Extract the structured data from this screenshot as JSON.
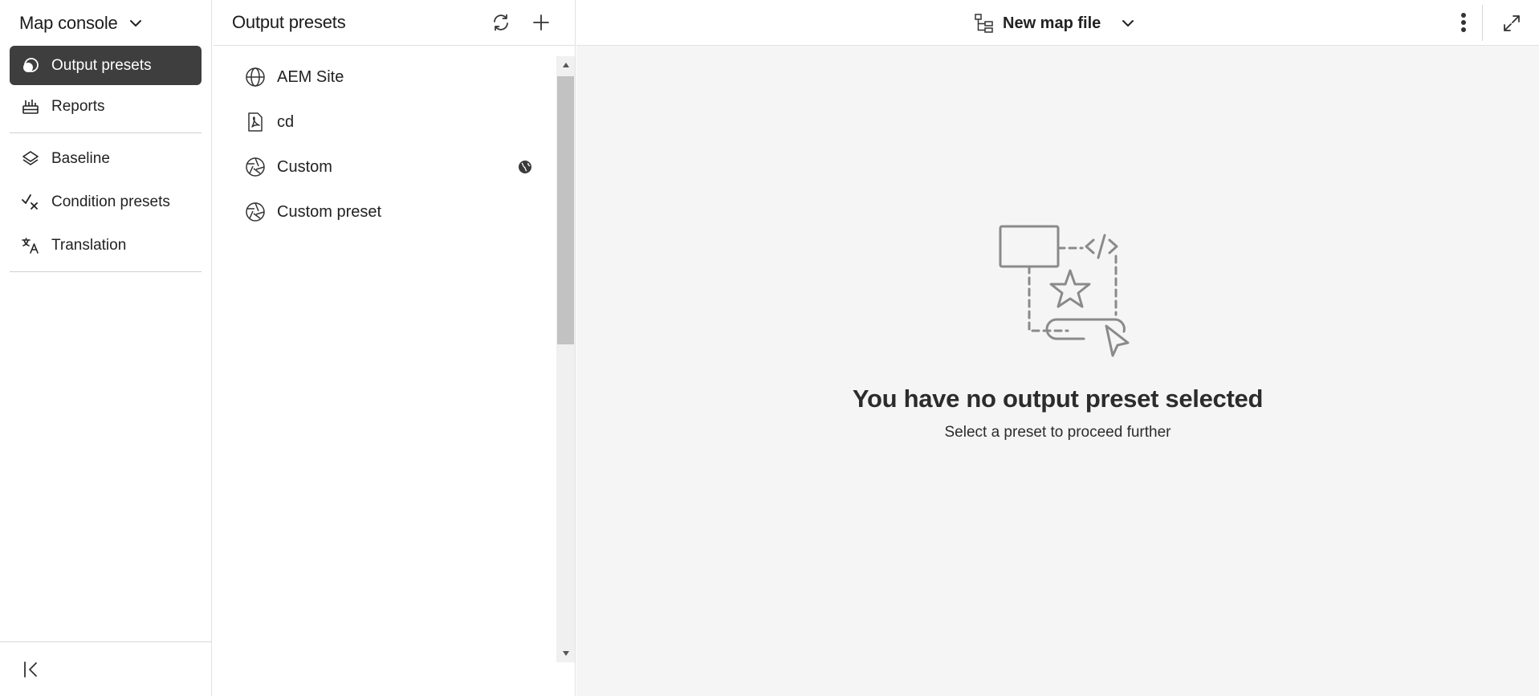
{
  "nav": {
    "title": "Map console",
    "title_chevron_icon": "chevron-down-icon",
    "items": [
      {
        "label": "Output presets",
        "icon": "output-presets-icon",
        "active": true
      },
      {
        "label": "Reports",
        "icon": "reports-icon",
        "active": false
      }
    ],
    "items2": [
      {
        "label": "Baseline",
        "icon": "layers-icon"
      },
      {
        "label": "Condition presets",
        "icon": "condition-icon"
      },
      {
        "label": "Translation",
        "icon": "translate-icon"
      }
    ],
    "collapse_icon": "collapse-left-icon"
  },
  "presets": {
    "title": "Output presets",
    "refresh_icon": "refresh-icon",
    "add_icon": "add-icon",
    "items": [
      {
        "label": "AEM Site",
        "icon": "globe-icon",
        "badge": null
      },
      {
        "label": "cd",
        "icon": "pdf-file-icon",
        "badge": null
      },
      {
        "label": "Custom",
        "icon": "aperture-icon",
        "badge": "global-badge-icon"
      },
      {
        "label": "Custom preset",
        "icon": "aperture-icon",
        "badge": null
      }
    ]
  },
  "main": {
    "file_name": "New map file",
    "file_icon": "tree-structure-icon",
    "file_chevron_icon": "chevron-down-icon",
    "more_icon": "more-vertical-icon",
    "expand_icon": "expand-icon",
    "empty_title": "You have no output preset selected",
    "empty_subtitle": "Select a preset to proceed further"
  },
  "colors": {
    "active_nav_bg": "#3e3e3e",
    "main_bg": "#f5f5f5",
    "border": "#e1e1e1",
    "illustration_stroke": "#8a8a8a"
  }
}
